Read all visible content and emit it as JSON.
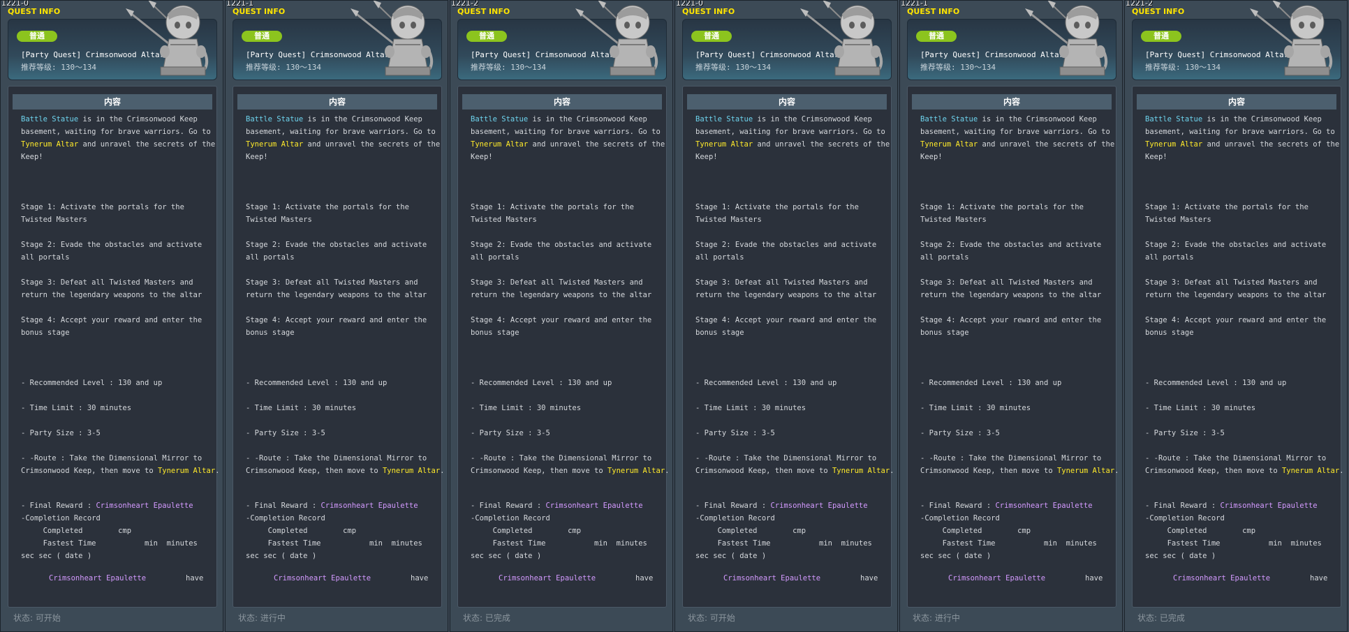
{
  "panels": [
    {
      "id": "1221-0",
      "state": "状态: 可开始"
    },
    {
      "id": "1221-1",
      "state": "状态: 进行中"
    },
    {
      "id": "1221-2",
      "state": "状态: 已完成"
    },
    {
      "id": "1221-0",
      "state": "状态: 可开始"
    },
    {
      "id": "1221-1",
      "state": "状态: 进行中"
    },
    {
      "id": "1221-2",
      "state": "状态: 已完成"
    }
  ],
  "quest": {
    "header_label": "QUEST INFO",
    "badge": "普通",
    "title": "[Party Quest] Crimsonwood Altar",
    "level": "推荐等级: 130～134",
    "content_header": "内容",
    "battle_statue": "Battle Statue",
    "intro_1": " is in the Crimsonwood Keep",
    "intro_2": "basement, waiting for brave warriors. Go to",
    "tynerum_altar": "Tynerum Altar",
    "intro_3": " and unravel the secrets of the",
    "intro_4": "Keep!",
    "stage1a": "Stage 1: Activate the portals for the",
    "stage1b": "Twisted Masters",
    "stage2a": "Stage 2: Evade the obstacles and activate",
    "stage2b": "all portals",
    "stage3a": "Stage 3: Defeat all Twisted Masters and",
    "stage3b": "return the legendary weapons to the altar",
    "stage4a": "Stage 4: Accept your reward and enter the",
    "stage4b": "bonus stage",
    "rec_level": "- Recommended Level : 130 and up",
    "time_limit": "- Time Limit : 30 minutes",
    "party_size": "- Party Size : 3-5",
    "route_a": "- -Route : Take the Dimensional Mirror to",
    "route_b": "Crimsonwood Keep, then move to ",
    "route_tynerum": "Tynerum Altar",
    "route_end": ".",
    "reward_label": "- Final Reward :  ",
    "reward_item": "Crimsonheart Epaulette",
    "completion_record": "-Completion Record",
    "completed": "     Completed        cmp",
    "fastest_time": "     Fastest Time           min  minutes",
    "sec_date": "sec  sec ( date )",
    "epaulette": "Crimsonheart Epaulette",
    "have": "have"
  }
}
